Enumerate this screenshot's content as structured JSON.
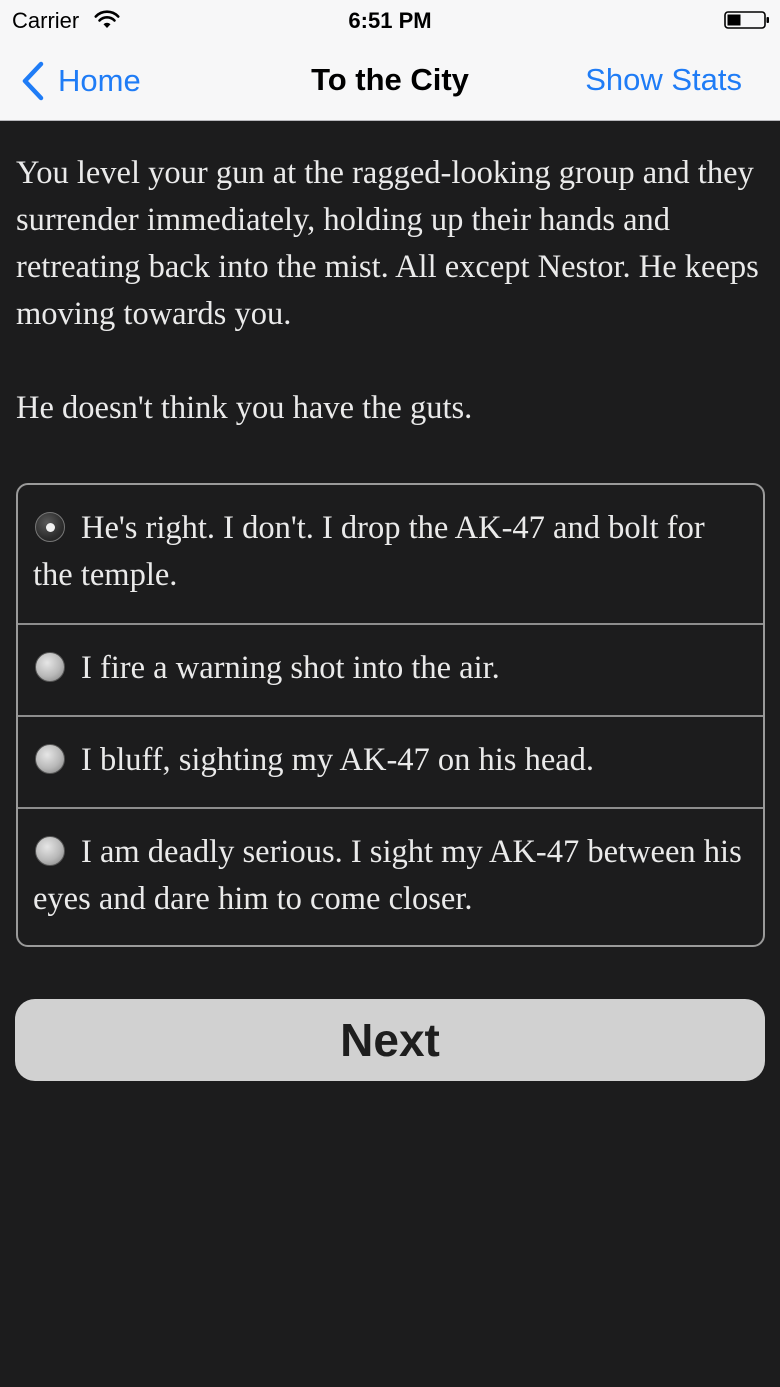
{
  "status_bar": {
    "carrier": "Carrier",
    "time": "6:51 PM"
  },
  "nav": {
    "back_label": "Home",
    "title": "To the City",
    "right_label": "Show Stats"
  },
  "story": {
    "paragraphs": [
      "You level your gun at the ragged-looking group and they surrender immediately, holding up their hands and retreating back into the mist. All except Nestor. He keeps moving towards you.",
      "He doesn't think you have the guts."
    ]
  },
  "choices": {
    "selected_index": 0,
    "items": [
      {
        "label": "He's right. I don't. I drop the AK-47 and bolt for the temple."
      },
      {
        "label": "I fire a warning shot into the air."
      },
      {
        "label": "I bluff, sighting my AK-47 on his head."
      },
      {
        "label": "I am deadly serious. I sight my AK-47 between his eyes and dare him to come closer."
      }
    ]
  },
  "next_button": {
    "label": "Next"
  },
  "colors": {
    "accent": "#1f7cf6",
    "background": "#1c1c1d",
    "nav_background": "#f7f7f8",
    "button_background": "#d1d1d1"
  }
}
